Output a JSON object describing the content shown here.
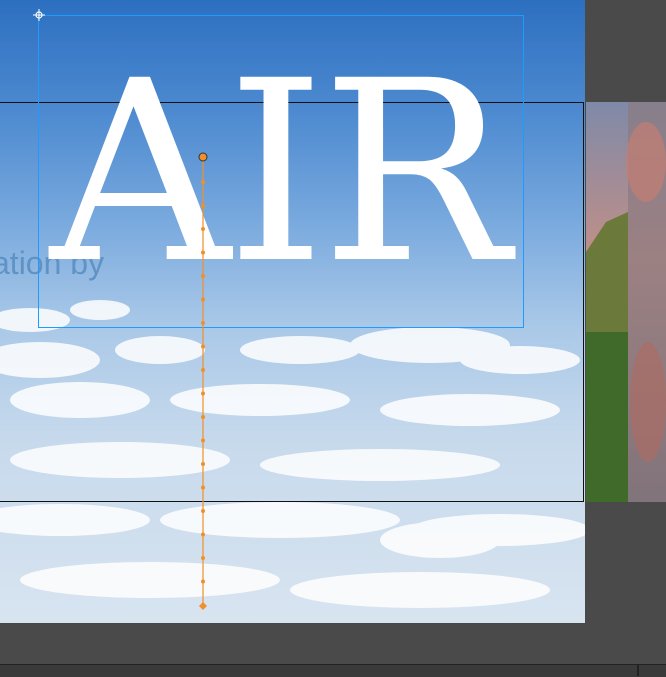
{
  "canvas": {
    "title_text": "AIR",
    "caption_text": "ation by"
  },
  "colors": {
    "selection": "#1e9bff",
    "motion_path": "#f0902a",
    "title": "#ffffff",
    "caption": "#5f93c5"
  },
  "icons": {
    "crosshair": "move-crosshair-icon",
    "anchor": "motion-path-anchor-icon"
  }
}
